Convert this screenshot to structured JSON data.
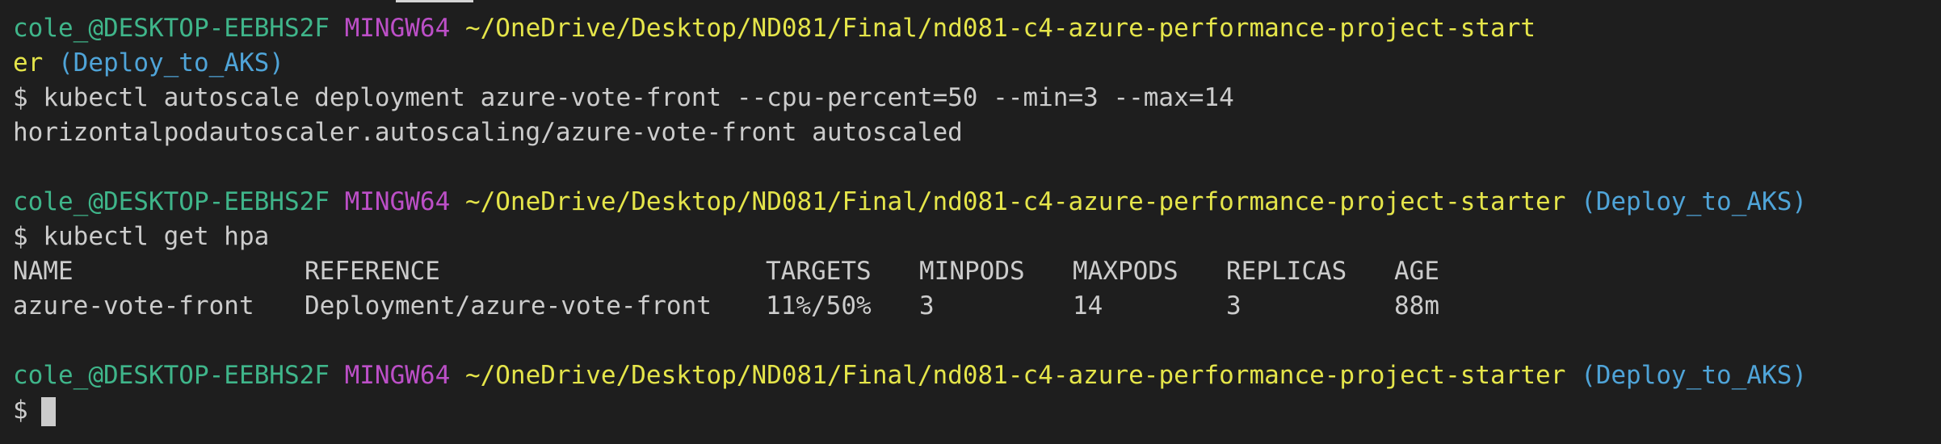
{
  "blocks": [
    {
      "prompt": {
        "user": "cole_@DESKTOP-EEBHS2F",
        "env": "MINGW64",
        "path_part1": "~/OneDrive/Desktop/ND081/Final/nd081-c4-azure-performance-project-start",
        "path_part2": "er",
        "branch": "(Deploy_to_AKS)"
      },
      "command": "$ kubectl autoscale deployment azure-vote-front --cpu-percent=50 --min=3 --max=14",
      "output": "horizontalpodautoscaler.autoscaling/azure-vote-front autoscaled"
    },
    {
      "prompt": {
        "user": "cole_@DESKTOP-EEBHS2F",
        "env": "MINGW64",
        "path": "~/OneDrive/Desktop/ND081/Final/nd081-c4-azure-performance-project-starter",
        "branch": "(Deploy_to_AKS)"
      },
      "command": "$ kubectl get hpa",
      "table": {
        "headers": [
          "NAME",
          "REFERENCE",
          "TARGETS",
          "MINPODS",
          "MAXPODS",
          "REPLICAS",
          "AGE"
        ],
        "rows": [
          [
            "azure-vote-front",
            "Deployment/azure-vote-front",
            "11%/50%",
            "3",
            "14",
            "3",
            "88m"
          ]
        ]
      }
    },
    {
      "prompt": {
        "user": "cole_@DESKTOP-EEBHS2F",
        "env": "MINGW64",
        "path": "~/OneDrive/Desktop/ND081/Final/nd081-c4-azure-performance-project-starter",
        "branch": "(Deploy_to_AKS)"
      },
      "command": "$"
    }
  ]
}
